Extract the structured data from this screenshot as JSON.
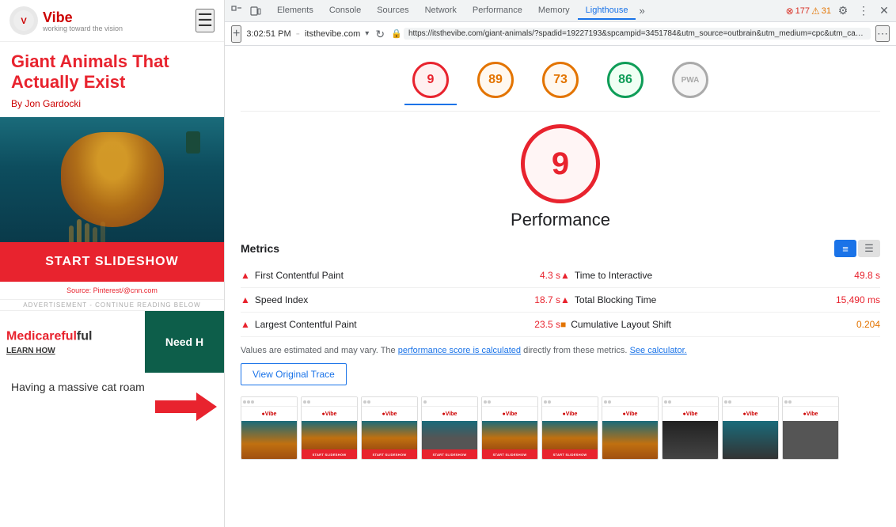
{
  "left": {
    "logo_text": "Vibe",
    "logo_subtext": "working toward the vision",
    "article_title": "Giant Animals That Actually Exist",
    "byline_prefix": "By ",
    "byline_author": "Jon Gardocki",
    "slideshow_btn": "START SLIDESHOW",
    "source_text": "Source: Pinterest/@cnn.com",
    "ad_banner": "ADVERTISEMENT - CONTINUE READING BELOW",
    "medicareful_left": "Medi",
    "medicareful_highlight": "careful",
    "medicareful_right": "",
    "learn_how": "LEARN HOW",
    "ad_right_text": "Need H",
    "article_bottom": "Having a massive cat roam"
  },
  "devtools": {
    "tabs": [
      "Elements",
      "Console",
      "Sources",
      "Network",
      "Performance",
      "Memory",
      "Lighthouse"
    ],
    "active_tab": "Lighthouse",
    "error_count": "177",
    "warn_count": "31",
    "time": "3:02:51 PM",
    "site": "itsthevibe.com",
    "url": "https://itsthevibe.com/giant-animals/?spadid=19227193&spcampid=3451784&utm_source=outbrain&utm_medium=cpc&utm_campaign=itv_...",
    "scores": [
      {
        "value": "9",
        "type": "red",
        "active": true
      },
      {
        "value": "89",
        "type": "orange"
      },
      {
        "value": "73",
        "type": "orange"
      },
      {
        "value": "86",
        "type": "green"
      },
      {
        "value": "PWA",
        "type": "gray"
      }
    ],
    "big_score": "9",
    "big_score_label": "Performance",
    "metrics_title": "Metrics",
    "metrics": [
      {
        "name": "First Contentful Paint",
        "value": "4.3 s",
        "color": "red",
        "side": "left"
      },
      {
        "name": "Time to Interactive",
        "value": "49.8 s",
        "color": "red",
        "side": "right"
      },
      {
        "name": "Speed Index",
        "value": "18.7 s",
        "color": "red",
        "side": "left"
      },
      {
        "name": "Total Blocking Time",
        "value": "15,490 ms",
        "color": "red",
        "side": "right"
      },
      {
        "name": "Largest Contentful Paint",
        "value": "23.5 s",
        "color": "red",
        "side": "left"
      },
      {
        "name": "Cumulative Layout Shift",
        "value": "0.204",
        "color": "orange",
        "side": "right"
      }
    ],
    "values_note": "Values are estimated and may vary. The ",
    "values_note_link1": "performance score is calculated",
    "values_note_mid": " directly from these metrics. ",
    "values_note_link2": "See calculator.",
    "view_trace_btn": "View Original Trace"
  }
}
